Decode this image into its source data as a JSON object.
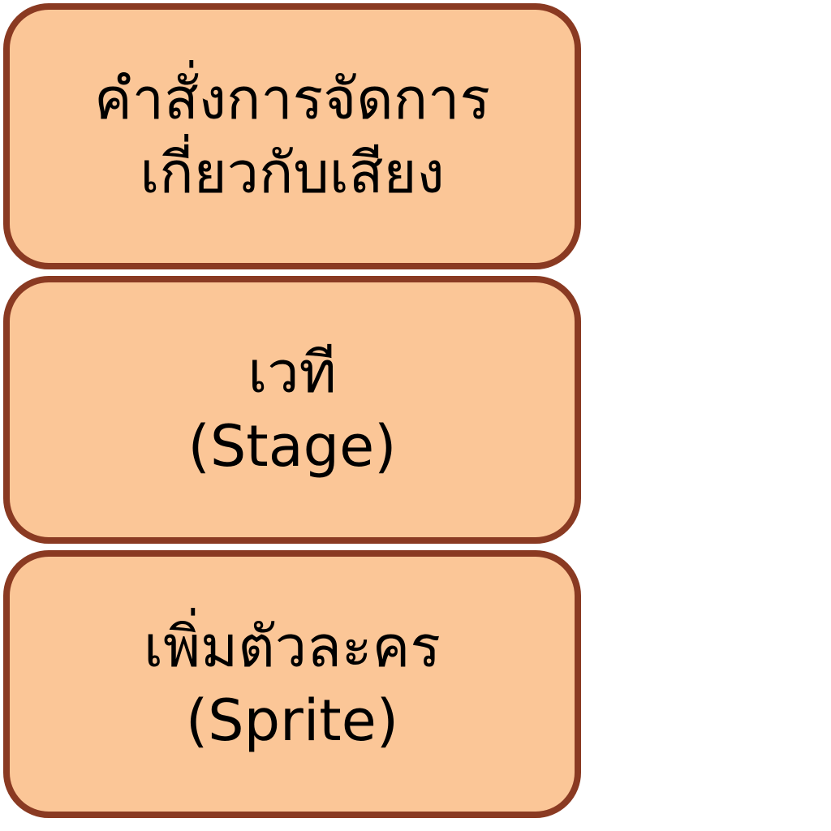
{
  "buttons": [
    {
      "line1": "คำสั่งการจัดการ",
      "line2": "เกี่ยวกับเสียง"
    },
    {
      "line1": "เวที",
      "line2": "(Stage)"
    },
    {
      "line1": "เพิ่มตัวละคร",
      "line2": "(Sprite)"
    }
  ],
  "colors": {
    "card_fill": "#fbc697",
    "card_border": "#8a3a22",
    "text": "#000000",
    "background": "#ffffff"
  }
}
